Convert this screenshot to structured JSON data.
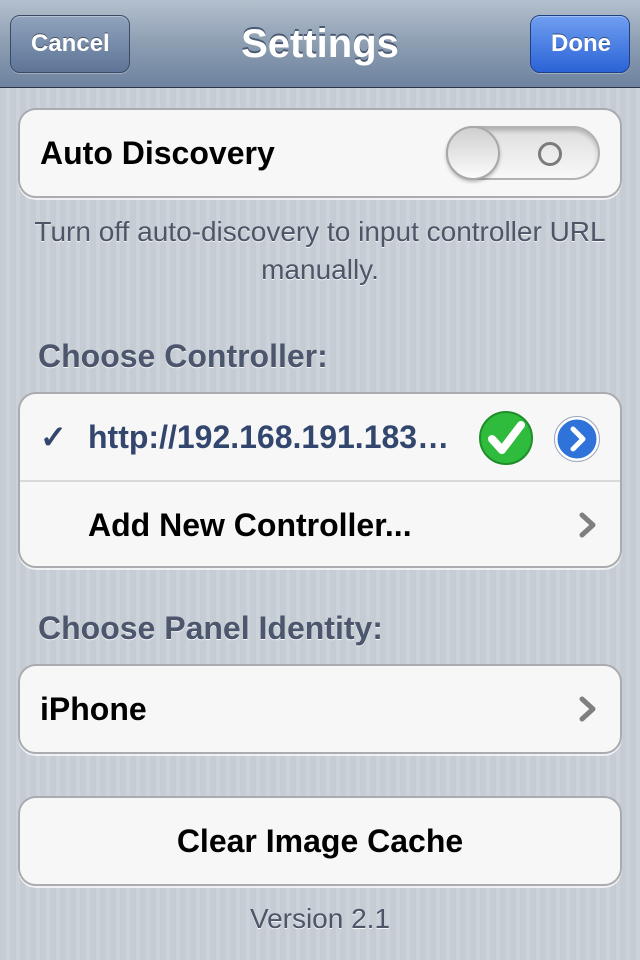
{
  "navbar": {
    "title": "Settings",
    "cancel_label": "Cancel",
    "done_label": "Done"
  },
  "auto_discovery": {
    "label": "Auto Discovery",
    "enabled": false,
    "footer": "Turn off auto-discovery to input controller URL manually."
  },
  "controllers": {
    "header": "Choose Controller:",
    "items": [
      {
        "checkmark": "✓",
        "url": "http://192.168.191.183…",
        "status_icon": "green-check-icon",
        "accessory_icon": "detail-disclosure-icon"
      },
      {
        "label": "Add New Controller...",
        "accessory_icon": "chevron-right-icon"
      }
    ]
  },
  "panel_identity": {
    "header": "Choose Panel Identity:",
    "value": "iPhone"
  },
  "clear_cache_label": "Clear Image Cache",
  "version": "Version 2.1",
  "colors": {
    "accent_blue": "#2b63d6",
    "check_green": "#2fbb3c",
    "cell_text_blue": "#33466e"
  }
}
